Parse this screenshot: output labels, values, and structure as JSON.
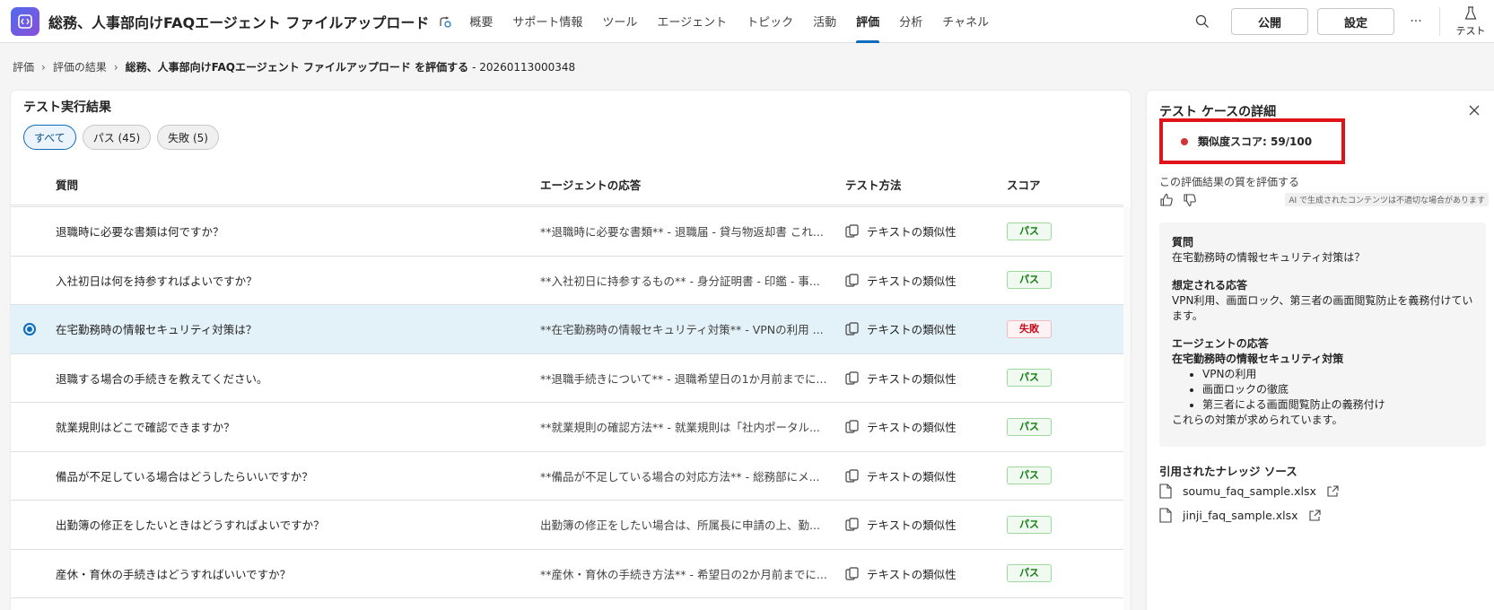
{
  "header": {
    "app_title": "総務、人事部向けFAQエージェント ファイルアップロード",
    "nav": [
      "概要",
      "サポート情報",
      "ツール",
      "エージェント",
      "トピック",
      "活動",
      "評価",
      "分析",
      "チャネル"
    ],
    "active_nav": "評価",
    "publish_label": "公開",
    "settings_label": "設定",
    "more_label": "···",
    "test_label": "テスト"
  },
  "breadcrumb": {
    "root": "評価",
    "results": "評価の結果",
    "current": "総務、人事部向けFAQエージェント ファイルアップロード を評価する",
    "suffix": "- 20260113000348"
  },
  "results": {
    "title": "テスト実行結果",
    "filters": [
      "すべて",
      "パス (45)",
      "失敗 (5)"
    ],
    "active_filter": "すべて",
    "columns": {
      "question": "質問",
      "answer": "エージェントの応答",
      "method": "テスト方法",
      "score": "スコア"
    },
    "rows": [
      {
        "question": "退職時に必要な書類は何ですか？",
        "answer": "**退職時に必要な書類** - 退職届 - 貸与物返却書 これ...",
        "method": "テキストの類似性",
        "score": "パス",
        "selected": false
      },
      {
        "question": "入社初日は何を持参すればよいですか？",
        "answer": "**入社初日に持参するもの** - 身分証明書 - 印鑑 - 事...",
        "method": "テキストの類似性",
        "score": "パス",
        "selected": false
      },
      {
        "question": "在宅勤務時の情報セキュリティ対策は？",
        "answer": "**在宅勤務時の情報セキュリティ対策** - VPNの利用 ...",
        "method": "テキストの類似性",
        "score": "失敗",
        "selected": true
      },
      {
        "question": "退職する場合の手続きを教えてください。",
        "answer": "**退職手続きについて** - 退職希望日の1か月前までに...",
        "method": "テキストの類似性",
        "score": "パス",
        "selected": false
      },
      {
        "question": "就業規則はどこで確認できますか？",
        "answer": "**就業規則の確認方法** - 就業規則は「社内ポータル...",
        "method": "テキストの類似性",
        "score": "パス",
        "selected": false
      },
      {
        "question": "備品が不足している場合はどうしたらいいですか？",
        "answer": "**備品が不足している場合の対応方法** - 総務部にメ...",
        "method": "テキストの類似性",
        "score": "パス",
        "selected": false
      },
      {
        "question": "出勤簿の修正をしたいときはどうすればよいですか？",
        "answer": "出勤簿の修正をしたい場合は、所属長に申請の上、勤...",
        "method": "テキストの類似性",
        "score": "パス",
        "selected": false
      },
      {
        "question": "産休・育休の手続きはどうすればいいですか？",
        "answer": "**産休・育休の手続き方法** - 希望日の2か月前までに...",
        "method": "テキストの類似性",
        "score": "パス",
        "selected": false
      }
    ]
  },
  "detail": {
    "title": "テスト ケースの詳細",
    "score_text": "類似度スコア: 59/100",
    "score_value": 59,
    "score_max": 100,
    "rate_label": "この評価結果の質を評価する",
    "ai_note": "AI で生成されたコンテンツは不適切な場合があります",
    "question_label": "質問",
    "question": "在宅勤務時の情報セキュリティ対策は？",
    "expected_label": "想定される応答",
    "expected": "VPN利用、画面ロック、第三者の画面閲覧防止を義務付けています。",
    "agent_label": "エージェントの応答",
    "agent_heading": "在宅勤務時の情報セキュリティ対策",
    "agent_items": [
      "VPNの利用",
      "画面ロックの徹底",
      "第三者による画面閲覧防止の義務付け"
    ],
    "agent_closing": "これらの対策が求められています。",
    "sources_title": "引用されたナレッジ ソース",
    "sources": [
      "soumu_faq_sample.xlsx",
      "jinji_faq_sample.xlsx"
    ]
  },
  "colors": {
    "accent": "#0f6cbd",
    "pass": "#107c10",
    "fail": "#c50f1f",
    "highlight_box": "#e0131a",
    "selected_row": "#e3f1f8"
  }
}
